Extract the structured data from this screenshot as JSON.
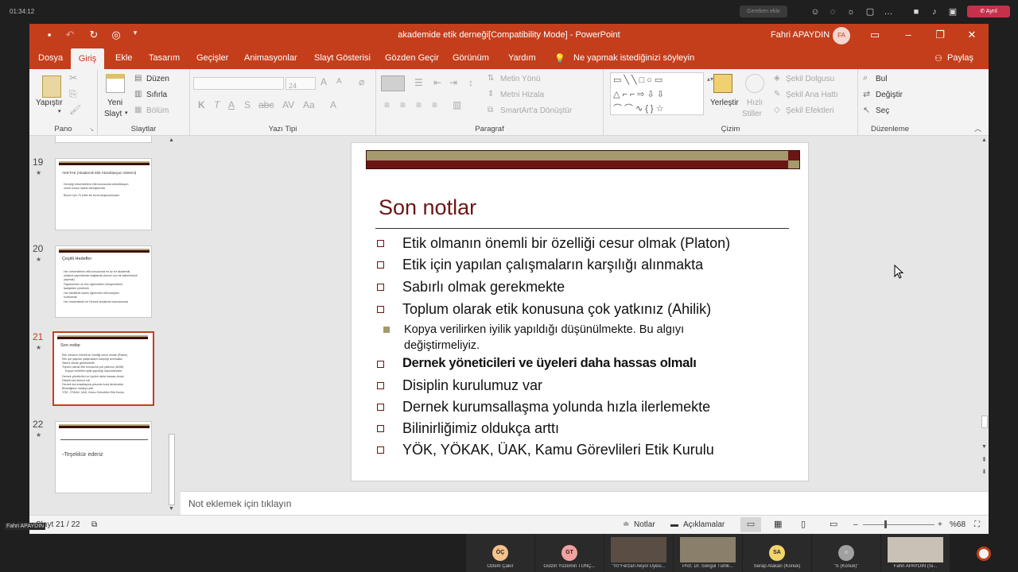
{
  "meeting": {
    "time": "01:34:12",
    "pill_label": "Gereken ekle",
    "leave_label": "Ayrıl",
    "presenter_overlay": "Fahri APAYDIN",
    "participants": [
      {
        "initials": "ÖÇ",
        "name": "Özlem Çakır",
        "color": "#f6c28b",
        "video": false
      },
      {
        "initials": "GT",
        "name": "Gülzin Yüzemin TUNÇ...",
        "color": "#f3a0a0",
        "video": false
      },
      {
        "initials": "",
        "name": "\"\\\\\\\\\"Ferzan Akyol Üyesi...",
        "color": "#999999",
        "video": true
      },
      {
        "initials": "",
        "name": "Prof. Dr. Songül Tümk...",
        "color": "#999999",
        "video": true
      },
      {
        "initials": "SA",
        "name": "Serap Atakan (Konuk)",
        "color": "#f2d46b",
        "video": false
      },
      {
        "initials": "",
        "name": "\"S (Konuk)\"",
        "color": "#a0a0a0",
        "video": false
      },
      {
        "initials": "",
        "name": "Fahri APAYDIN (Si...",
        "color": "#999999",
        "video": true
      }
    ]
  },
  "window": {
    "title": "akademide etik derneği[Compatibility Mode] - PowerPoint",
    "user": "Fahri APAYDIN",
    "user_initials": "FA",
    "accent": "#c43e1c"
  },
  "tabs": [
    "Dosya",
    "Giriş",
    "Ekle",
    "Tasarım",
    "Geçişler",
    "Animasyonlar",
    "Slayt Gösterisi",
    "Gözden Geçir",
    "Görünüm",
    "Yardım"
  ],
  "tell_me": "Ne yapmak istediğinizi söyleyin",
  "share": "Paylaş",
  "ribbon": {
    "pano": {
      "label": "Pano",
      "paste": "Yapıştır"
    },
    "slaytlar": {
      "label": "Slaytlar",
      "new_slide": "Yeni",
      "new_slide2": "Slayt",
      "layout": "Düzen",
      "reset": "Sıfırla",
      "section": "Bölüm"
    },
    "yazi_tipi": {
      "label": "Yazı Tipi",
      "font_size": "24"
    },
    "paragraf": {
      "label": "Paragraf",
      "text_direction": "Metin Yönü",
      "align_text": "Metni Hizala",
      "smartart": "SmartArt'a Dönüştür"
    },
    "cizim": {
      "label": "Çizim",
      "arrange": "Yerleştir",
      "quick_styles": "Hızlı",
      "quick_styles2": "Stiller",
      "shape_fill": "Şekil Dolgusu",
      "shape_outline": "Şekil Ana Hattı",
      "shape_effects": "Şekil Efektleri"
    },
    "duzenleme": {
      "label": "Düzenleme",
      "find": "Bul",
      "replace": "Değiştir",
      "select": "Seç"
    }
  },
  "thumbnails": [
    {
      "number": "19",
      "title": "AKETAS (Akademik Etik Akreditasyon Sistemi)",
      "lines": [
        "Derneği üniversitelere etik konusunda akreditasyon",
        "veren kurum haline dönüştürmek",
        "Bunun için 70 kriter bir kural oluşturulmuştur"
      ]
    },
    {
      "number": "20",
      "title": "Çeşitli Hedefler",
      "lines": [
        "Her üniversitenin etik konusunda en az bir akademik",
        "çalışma yayınlaması bağlamak (kurum için bir kalemleşme",
        "yapmak)",
        "Öğretmenler ve tüm öğrencilerin bilinçlendirme",
        "faaliyetleri yürütmek",
        "Her fakültede bazen öğrenciler etik kulüpleri",
        "kurdurmak",
        "Her üniversitede bir Dernek temsilcisi bulundurmak"
      ]
    },
    {
      "number": "21",
      "title": "Son notlar",
      "lines": [
        "Etik olmanın önemli bir özelliği cesur olmak (Platon)",
        "Etik için yapılan çalışmaların karşılığı alınmakta",
        "Sabırlı olmak gerekmekte",
        "Toplum olarak etik konusuna çok yatkınız (Ahilik)",
        "Kopya verilirken iyilik yapıldığı düşünülmekte",
        "Dernek yöneticileri ve üyeleri daha hassas olmalı",
        "Disiplin kurulumuz var",
        "Dernek kurumsallaşma yolunda hızla ilerlemekte",
        "Bilinirliğimiz oldukça arttı",
        "YÖK, YÖKAK, ÜAK, Kamu Görevlileri Etik Kurulu"
      ]
    },
    {
      "number": "22",
      "title": "",
      "lines": [
        "Teşekkür ederiz"
      ]
    }
  ],
  "slide": {
    "title": "Son notlar",
    "bullets": [
      "Etik olmanın önemli bir özelliği cesur olmak (Platon)",
      "Etik için yapılan çalışmaların karşılığı alınmakta",
      "Sabırlı olmak gerekmekte",
      "Toplum olarak etik konusuna çok yatkınız (Ahilik)"
    ],
    "sub_bullet": "Kopya verilirken iyilik yapıldığı düşünülmekte. Bu algıyı değiştirmeliyiz.",
    "bullets2": [
      "Dernek yöneticileri ve üyeleri daha hassas olmalı",
      "Disiplin kurulumuz var",
      "Dernek kurumsallaşma yolunda hızla ilerlemekte",
      "Bilinirliğimiz oldukça arttı",
      "YÖK, YÖKAK, ÜAK, Kamu Görevlileri Etik Kurulu"
    ]
  },
  "notes_placeholder": "Not eklemek için tıklayın",
  "status": {
    "slide_counter": "Slayt 21 / 22",
    "notes": "Notlar",
    "comments": "Açıklamalar",
    "zoom": "%68"
  }
}
